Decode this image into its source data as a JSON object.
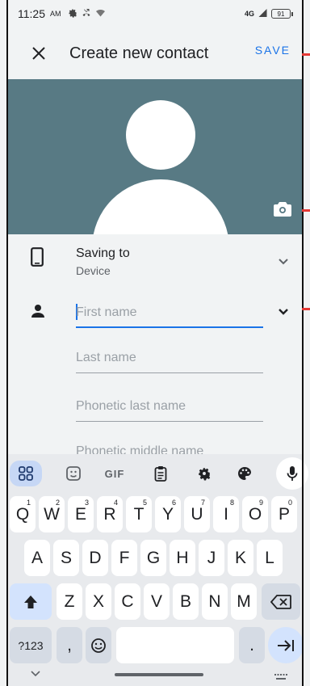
{
  "status_bar": {
    "time": "11:25",
    "ampm": "AM",
    "network": "4G",
    "battery": "91"
  },
  "app_bar": {
    "title": "Create new contact",
    "save_label": "SAVE"
  },
  "saving_to": {
    "label": "Saving to",
    "value": "Device"
  },
  "fields": {
    "first_name_placeholder": "First name",
    "last_name_placeholder": "Last name",
    "phonetic_last_name_placeholder": "Phonetic last name",
    "phonetic_middle_name_placeholder": "Phonetic middle name"
  },
  "keyboard": {
    "toolbar": {
      "gif_label": "GIF"
    },
    "row1": [
      {
        "k": "Q",
        "n": "1"
      },
      {
        "k": "W",
        "n": "2"
      },
      {
        "k": "E",
        "n": "3"
      },
      {
        "k": "R",
        "n": "4"
      },
      {
        "k": "T",
        "n": "5"
      },
      {
        "k": "Y",
        "n": "6"
      },
      {
        "k": "U",
        "n": "7"
      },
      {
        "k": "I",
        "n": "8"
      },
      {
        "k": "O",
        "n": "9"
      },
      {
        "k": "P",
        "n": "0"
      }
    ],
    "row2": [
      "A",
      "S",
      "D",
      "F",
      "G",
      "H",
      "J",
      "K",
      "L"
    ],
    "row3": [
      "Z",
      "X",
      "C",
      "V",
      "B",
      "N",
      "M"
    ],
    "row4": {
      "symbols": "?123",
      "comma": ",",
      "period": "."
    }
  },
  "colors": {
    "accent": "#1a73e8",
    "photo_bg": "#587a84",
    "marker": "#e53935"
  }
}
